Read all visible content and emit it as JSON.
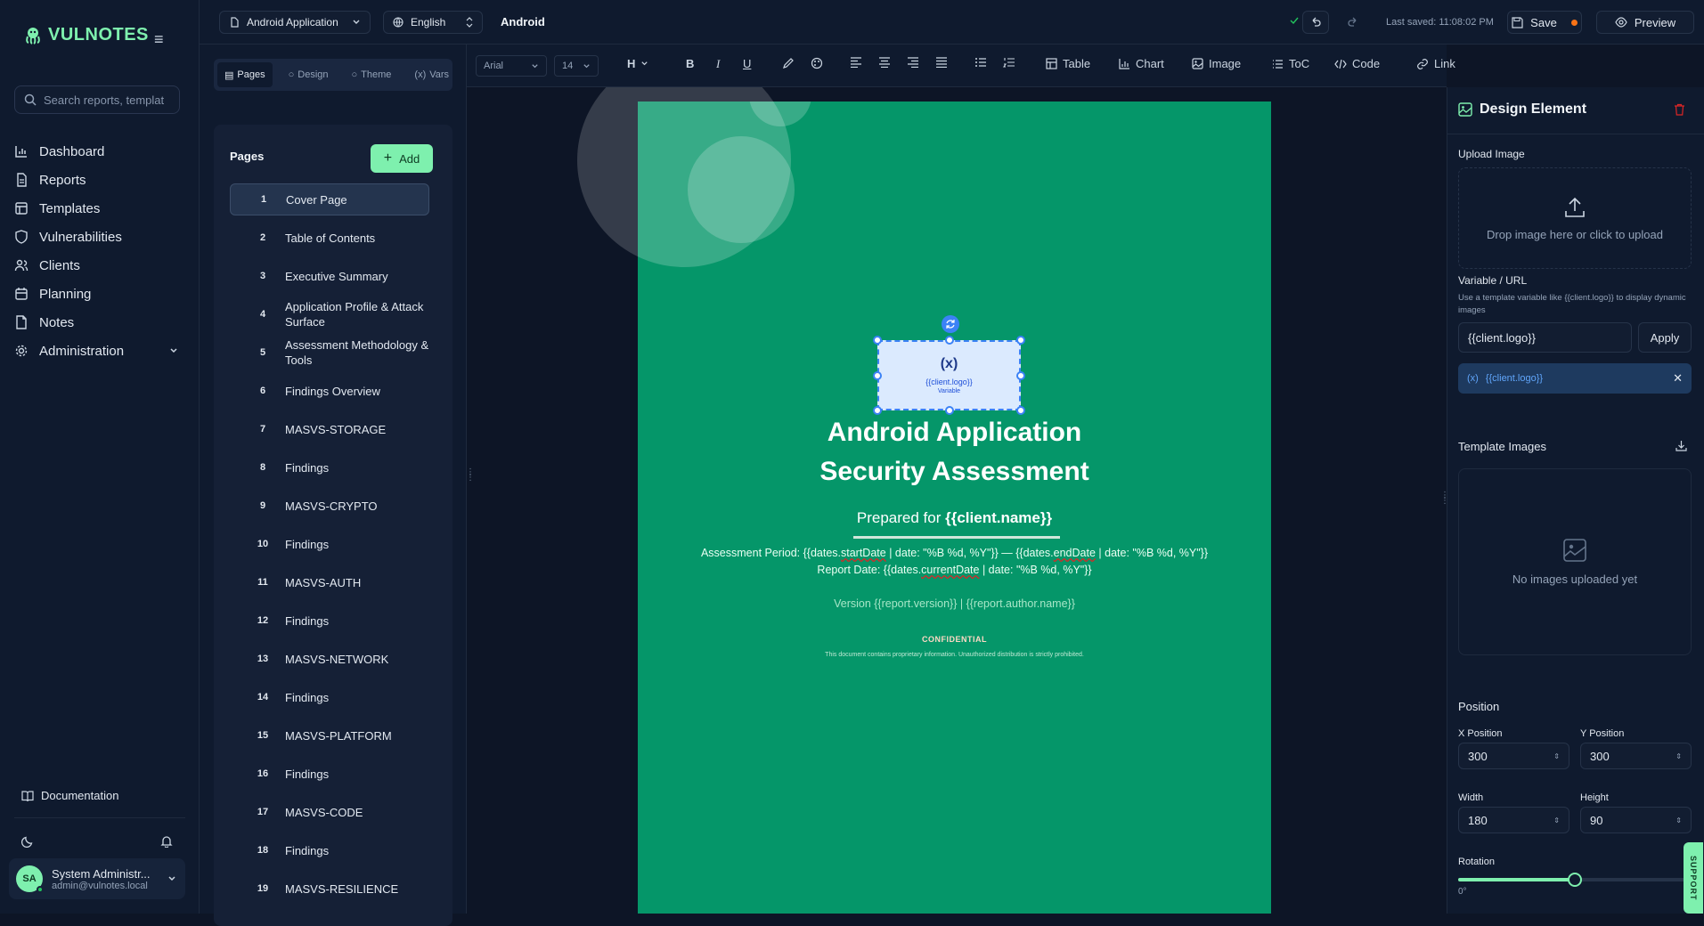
{
  "brand": {
    "name": "VULNOTES"
  },
  "search": {
    "placeholder": "Search reports, templat"
  },
  "nav": [
    {
      "label": "Dashboard",
      "icon": "bar-chart-icon"
    },
    {
      "label": "Reports",
      "icon": "file-icon"
    },
    {
      "label": "Templates",
      "icon": "layout-icon"
    },
    {
      "label": "Vulnerabilities",
      "icon": "shield-icon"
    },
    {
      "label": "Clients",
      "icon": "users-icon"
    },
    {
      "label": "Planning",
      "icon": "calendar-icon"
    },
    {
      "label": "Notes",
      "icon": "note-icon"
    },
    {
      "label": "Administration",
      "icon": "gear-icon"
    }
  ],
  "documentation": "Documentation",
  "user": {
    "initials": "SA",
    "name": "System Administr...",
    "email": "admin@vulnotes.local"
  },
  "topbar": {
    "template_select": "Android Application",
    "language_select": "English",
    "doc_title": "Android",
    "last_saved": "Last saved: 11:08:02 PM",
    "save_label": "Save",
    "preview_label": "Preview"
  },
  "panel_tabs": [
    "Pages",
    "Design",
    "Theme",
    "Vars"
  ],
  "pages_panel": {
    "title": "Pages",
    "add_label": "Add"
  },
  "pages": [
    {
      "num": "1",
      "label": "Cover Page"
    },
    {
      "num": "2",
      "label": "Table of Contents"
    },
    {
      "num": "3",
      "label": "Executive Summary"
    },
    {
      "num": "4",
      "label": "Application Profile & Attack Surface"
    },
    {
      "num": "5",
      "label": "Assessment Methodology & Tools"
    },
    {
      "num": "6",
      "label": "Findings Overview"
    },
    {
      "num": "7",
      "label": "MASVS-STORAGE"
    },
    {
      "num": "8",
      "label": "Findings"
    },
    {
      "num": "9",
      "label": "MASVS-CRYPTO"
    },
    {
      "num": "10",
      "label": "Findings"
    },
    {
      "num": "11",
      "label": "MASVS-AUTH"
    },
    {
      "num": "12",
      "label": "Findings"
    },
    {
      "num": "13",
      "label": "MASVS-NETWORK"
    },
    {
      "num": "14",
      "label": "Findings"
    },
    {
      "num": "15",
      "label": "MASVS-PLATFORM"
    },
    {
      "num": "16",
      "label": "Findings"
    },
    {
      "num": "17",
      "label": "MASVS-CODE"
    },
    {
      "num": "18",
      "label": "Findings"
    },
    {
      "num": "19",
      "label": "MASVS-RESILIENCE"
    }
  ],
  "toolbar": {
    "font": "Arial",
    "size": "14",
    "heading": "H",
    "table": "Table",
    "chart": "Chart",
    "image": "Image",
    "toc": "ToC",
    "code": "Code",
    "link": "Link"
  },
  "cover": {
    "image_var": "{{client.logo}}",
    "image_sub": "Variable",
    "title_line1": "Android Application",
    "title_line2": "Security Assessment",
    "prepared_prefix": "Prepared for ",
    "prepared_var": "{{client.name}}",
    "period_1": "Assessment Period: {{dates.",
    "period_start": "startDate",
    "period_2": " | date: \"%B %d, %Y\"}} — {{dates.",
    "period_end": "endDate",
    "period_3": " | date: \"%B %d, %Y\"}}",
    "report_1": "Report Date: {{dates.",
    "report_var": "currentDate",
    "report_2": " | date: \"%B %d, %Y\"}}",
    "version": "Version {{report.version}} | {{report.author.name}}",
    "confidential": "CONFIDENTIAL",
    "disclaimer": "This document contains proprietary information. Unauthorized distribution is strictly prohibited."
  },
  "rpanel": {
    "title": "Design Element",
    "upload_label": "Upload Image",
    "upload_hint": "Drop image here or click to upload",
    "var_label": "Variable / URL",
    "var_help": "Use a template variable like {{client.logo}} to display dynamic images",
    "var_value": "{{client.logo}}",
    "apply": "Apply",
    "chip": "{{client.logo}}",
    "template_images": "Template Images",
    "no_images": "No images uploaded yet",
    "position": "Position",
    "x_label": "X Position",
    "x_value": "300",
    "y_label": "Y Position",
    "y_value": "300",
    "w_label": "Width",
    "w_value": "180",
    "h_label": "Height",
    "h_value": "90",
    "rotation_label": "Rotation",
    "rotation_value": "0°",
    "rotation_fraction": 0.5
  },
  "support": "SUPPORT",
  "colors": {
    "accent": "#7ef0ae",
    "paper": "#059669",
    "bg": "#0d1526",
    "selection": "#3b82f6"
  }
}
